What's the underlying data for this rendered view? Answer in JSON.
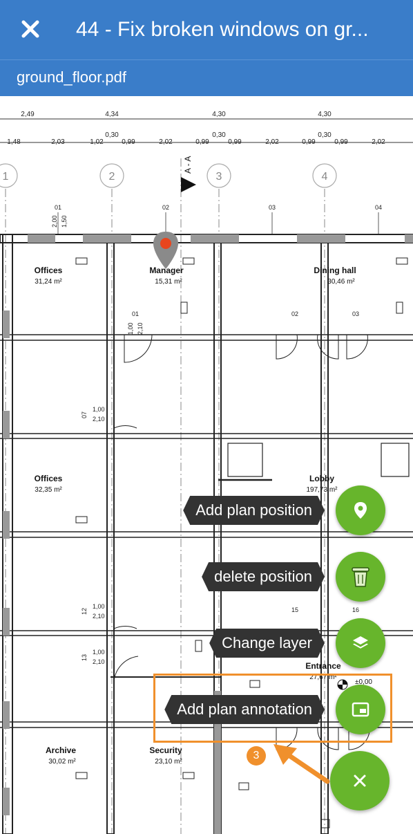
{
  "header": {
    "title": "44 - Fix broken windows on gr..."
  },
  "subheader": {
    "filename": "ground_floor.pdf"
  },
  "plan": {
    "dims_top": [
      "2,49",
      "4,34",
      "4,30",
      "4,30"
    ],
    "dims_bottom": [
      "1,48",
      "2,03",
      "1,02",
      "0,99",
      "2,02",
      "0,99",
      "0,99",
      "2,02",
      "0,99",
      "0,99",
      "2,02"
    ],
    "dims_small": [
      "0,30",
      "0,30",
      "0,30"
    ],
    "section": "A - A",
    "axes": [
      "1",
      "2",
      "3",
      "4"
    ],
    "window_ids": [
      "01",
      "02",
      "03",
      "04"
    ],
    "window_dims": [
      "2,00",
      "1,50"
    ],
    "door_ids": [
      "01",
      "02",
      "03"
    ],
    "door_dims": [
      "1,00",
      "2,10"
    ],
    "door_07": "07",
    "door_12": "12",
    "door_13": "13",
    "door_15": "15",
    "door_16": "16",
    "level": "±0,00",
    "rooms": [
      {
        "name": "Offices",
        "area": "31,24 m²"
      },
      {
        "name": "Manager",
        "area": "15,31 m²"
      },
      {
        "name": "Dining hall",
        "area": "30,46 m²"
      },
      {
        "name": "Offices",
        "area": "32,35 m²"
      },
      {
        "name": "Lobby",
        "area": "197,73 m²"
      },
      {
        "name": "Entrance",
        "area": "27,67 m²"
      },
      {
        "name": "Archive",
        "area": "30,02 m²"
      },
      {
        "name": "Security",
        "area": "23,10 m²"
      }
    ]
  },
  "actions": [
    {
      "label": "Add plan position",
      "icon": "map-pin-icon"
    },
    {
      "label": "delete position",
      "icon": "trash-icon"
    },
    {
      "label": "Change layer",
      "icon": "layers-icon"
    },
    {
      "label": "Add plan annotation",
      "icon": "annotation-icon"
    }
  ],
  "tutorial": {
    "step": "3"
  },
  "colors": {
    "header": "#3a7dc9",
    "fab": "#67b52c",
    "highlight": "#f0902c",
    "pin": "#e8451e"
  }
}
